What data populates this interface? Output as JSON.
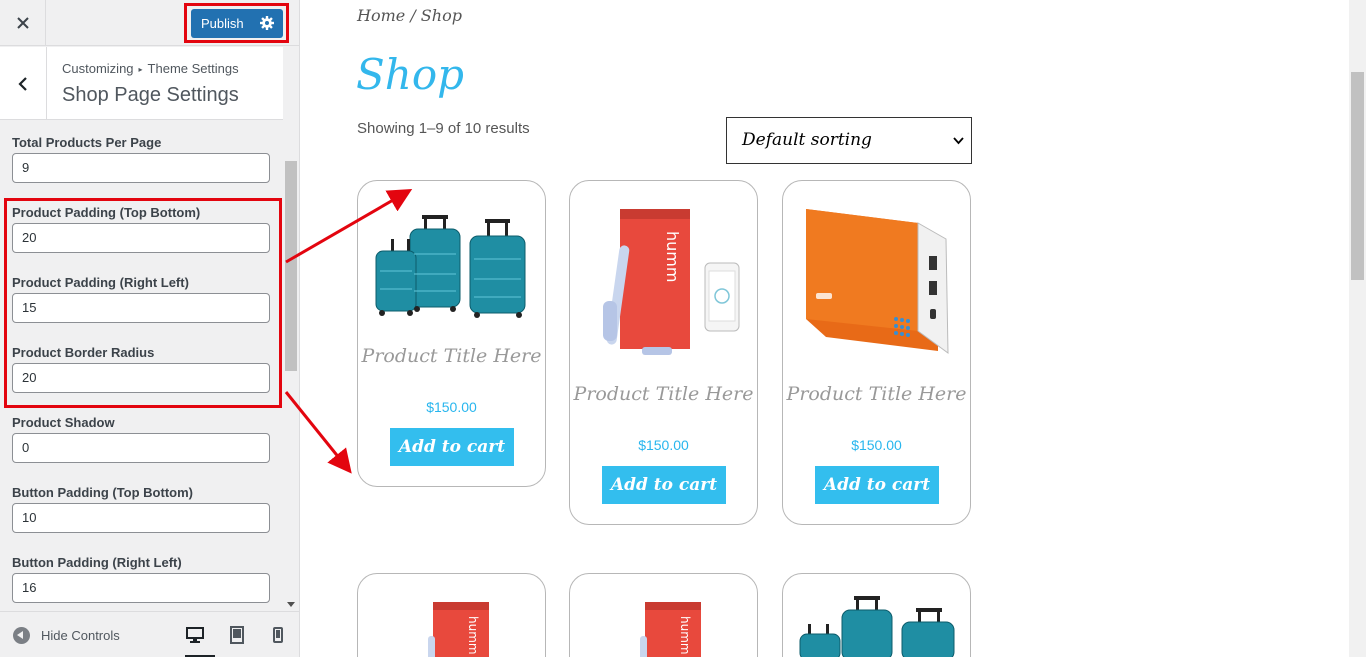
{
  "customizer": {
    "publish_label": "Publish",
    "breadcrumb_root": "Customizing",
    "breadcrumb_section": "Theme Settings",
    "section_title": "Shop Page Settings",
    "controls": [
      {
        "label": "Total Products Per Page",
        "value": "9"
      },
      {
        "label": "Product Padding (Top Bottom)",
        "value": "20"
      },
      {
        "label": "Product Padding (Right Left)",
        "value": "15"
      },
      {
        "label": "Product Border Radius",
        "value": "20"
      },
      {
        "label": "Product Shadow",
        "value": "0"
      },
      {
        "label": "Button Padding (Top Bottom)",
        "value": "10"
      },
      {
        "label": "Button Padding (Right Left)",
        "value": "16"
      }
    ],
    "hide_controls_label": "Hide Controls",
    "icons": {
      "close": "close-icon",
      "back": "chevron-left-icon",
      "gear": "gear-icon",
      "hide": "hide-controls-icon",
      "desktop": "desktop-icon",
      "tablet": "tablet-icon",
      "mobile": "mobile-icon"
    }
  },
  "preview": {
    "breadcrumb_home": "Home",
    "breadcrumb_sep": " / ",
    "breadcrumb_current": "Shop",
    "page_title": "Shop",
    "result_count": "Showing 1–9 of 10 results",
    "sort_selected": "Default sorting",
    "products": [
      {
        "title": "Product Title Here",
        "price": "$150.00",
        "button": "Add to cart",
        "image": "luggage-set"
      },
      {
        "title": "Product Title Here",
        "price": "$150.00",
        "button": "Add to cart",
        "image": "electric-toothbrush-kit"
      },
      {
        "title": "Product Title Here",
        "price": "$150.00",
        "button": "Add to cart",
        "image": "orange-power-bank"
      },
      {
        "image": "electric-toothbrush-kit"
      },
      {
        "image": "electric-toothbrush-kit"
      },
      {
        "image": "luggage-set"
      }
    ]
  },
  "colors": {
    "accent": "#33beee",
    "publish": "#2271b1",
    "highlight": "#e3050f"
  }
}
